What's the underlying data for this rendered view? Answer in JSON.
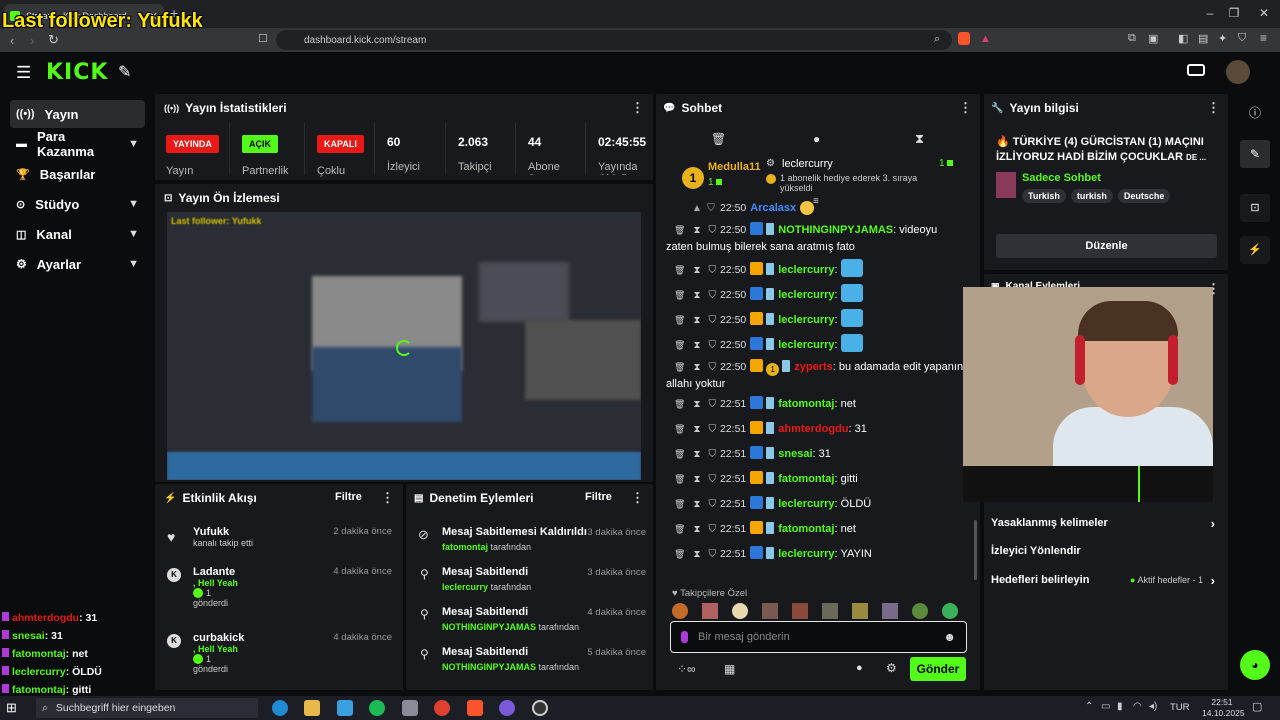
{
  "browser": {
    "tab_title": "Stream - Kick Dashboard",
    "url": "dashboard.kick.com/stream"
  },
  "overlay_text": "Last follower: Yufukk",
  "kick_logo": "KICK",
  "sidebar": {
    "items": [
      {
        "label": "Yayın",
        "icon": "broadcast-icon"
      },
      {
        "label": "Para Kazanma",
        "icon": "money-icon"
      },
      {
        "label": "Başarılar",
        "icon": "trophy-icon"
      },
      {
        "label": "Stüdyo",
        "icon": "studio-icon"
      },
      {
        "label": "Kanal",
        "icon": "channel-icon"
      },
      {
        "label": "Ayarlar",
        "icon": "gear-icon"
      }
    ]
  },
  "stats_panel": {
    "title": "Yayın İstatistikleri",
    "badges": [
      {
        "badge": "YAYINDA",
        "label": "Yayın",
        "color": "#e91916"
      },
      {
        "badge": "AÇIK",
        "label": "Partnerlik",
        "color": "#53fc18"
      },
      {
        "badge": "KAPALI",
        "label": "Çoklu",
        "color": "#e91916"
      }
    ],
    "values": [
      {
        "value": "60",
        "label": "İzleyici"
      },
      {
        "value": "2.063",
        "label": "Takipçi"
      },
      {
        "value": "44",
        "label": "Abone Sayısı"
      },
      {
        "value": "02:45:55",
        "label": "Yayında Olduğu"
      }
    ]
  },
  "preview_panel": {
    "title": "Yayın Ön İzlemesi",
    "preview_overlay": "Last follower: Yufukk"
  },
  "activity_feed": {
    "title": "Etkinlik Akışı",
    "filter": "Filtre",
    "items": [
      {
        "name": "Yufukk",
        "time": "2 dakika önce",
        "line1": "kanalı takip etti",
        "line2": "",
        "line3": ""
      },
      {
        "name": "Ladante",
        "time": "4 dakika önce",
        "line1": ", Hell Yeah",
        "line2": "1",
        "line3": "gönderdi"
      },
      {
        "name": "curbakick",
        "time": "4 dakika önce",
        "line1": ", Hell Yeah",
        "line2": "1",
        "line3": "gönderdi"
      }
    ]
  },
  "mod_actions": {
    "title": "Denetim Eylemleri",
    "filter": "Filtre",
    "suffix": "tarafından",
    "items": [
      {
        "action": "Mesaj Sabitlemesi Kaldırıldı",
        "time": "3 dakika önce",
        "user": "fatomontaj"
      },
      {
        "action": "Mesaj Sabitlendi",
        "time": "3 dakika önce",
        "user": "leclercurry"
      },
      {
        "action": "Mesaj Sabitlendi",
        "time": "4 dakika önce",
        "user": "NOTHINGINPYJAMAS"
      },
      {
        "action": "Mesaj Sabitlendi",
        "time": "5 dakika önce",
        "user": "NOTHINGINPYJAMAS"
      }
    ]
  },
  "chat": {
    "title": "Sohbet",
    "pinned": {
      "user": "Medulla11",
      "count": "1",
      "rank": "1",
      "gifter": "leclercurry",
      "gifter_count": "1",
      "text": "1 abonelik hediye ederek 3. sıraya yükseldi"
    },
    "partial_line": {
      "time": "22:50",
      "user": "Arcalasx"
    },
    "messages": [
      {
        "time": "22:50",
        "user": "NOTHINGINPYJAMAS",
        "text": "videoyu zaten bulmuş bilerek sana aratmış fato",
        "color": "#53fc18"
      },
      {
        "time": "22:50",
        "user": "leclercurry",
        "text": "",
        "color": "#53fc18"
      },
      {
        "time": "22:50",
        "user": "leclercurry",
        "text": "",
        "color": "#53fc18"
      },
      {
        "time": "22:50",
        "user": "leclercurry",
        "text": "",
        "color": "#53fc18"
      },
      {
        "time": "22:50",
        "user": "leclercurry",
        "text": "",
        "color": "#53fc18"
      },
      {
        "time": "22:50",
        "user": "zyperts",
        "text": "bu adamada edit yapanın allahı yoktur",
        "color": "#e91916",
        "badge_num": "1"
      },
      {
        "time": "22:51",
        "user": "fatomontaj",
        "text": "net",
        "color": "#53fc18"
      },
      {
        "time": "22:51",
        "user": "ahmterdogdu",
        "text": "31",
        "color": "#e91916"
      },
      {
        "time": "22:51",
        "user": "snesai",
        "text": "31",
        "color": "#53fc18"
      },
      {
        "time": "22:51",
        "user": "fatomontaj",
        "text": "gitti",
        "color": "#53fc18"
      },
      {
        "time": "22:51",
        "user": "leclercurry",
        "text": "ÖLDÜ",
        "color": "#53fc18"
      },
      {
        "time": "22:51",
        "user": "fatomontaj",
        "text": "net",
        "color": "#53fc18"
      },
      {
        "time": "22:51",
        "user": "leclercurry",
        "text": "YAYIN",
        "color": "#53fc18"
      }
    ],
    "followers_only": "Takipçilere Özel",
    "input_placeholder": "Bir mesaj gönderin",
    "send_label": "Gönder"
  },
  "stream_info": {
    "title": "Yayın bilgisi",
    "stream_title": "🔥 TÜRKİYE (4) GÜRCİSTAN (1) MAÇINI İZLİYORUZ HADİ BİZİM ÇOCUKLAR",
    "stream_title_suffix": "DE ...",
    "category": "Sadece Sohbet",
    "tags": [
      "Turkish",
      "turkish",
      "Deutsche"
    ],
    "edit_label": "Düzenle"
  },
  "channel_actions": {
    "title": "Kanal Eylemleri",
    "items": [
      {
        "label": "Yasaklanmış kelimeler",
        "extra": ""
      },
      {
        "label": "İzleyici Yönlendir",
        "extra": ""
      },
      {
        "label": "Hedefleri belirleyin",
        "extra": "Aktif hedefler - 1"
      }
    ]
  },
  "overlay_chat": [
    {
      "user": "ahmterdogdu",
      "text": ": 31",
      "color": "#e91916"
    },
    {
      "user": "snesai",
      "text": ": 31",
      "color": "#53fc18"
    },
    {
      "user": "fatomontaj",
      "text": ": net",
      "color": "#53fc18"
    },
    {
      "user": "leclercurry",
      "text": ": ÖLDÜ",
      "color": "#53fc18"
    },
    {
      "user": "fatomontaj",
      "text": ": gitti",
      "color": "#53fc18"
    }
  ],
  "taskbar": {
    "search_placeholder": "Suchbegriff hier eingeben",
    "lang": "TUR",
    "time": "22:51",
    "date": "14.10.2025"
  }
}
